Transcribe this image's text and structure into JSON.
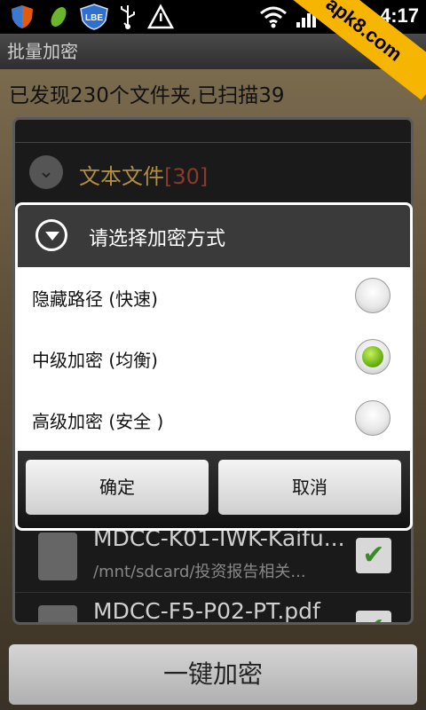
{
  "status_bar": {
    "clock": "4:17",
    "icons": [
      "shield-icon",
      "leaf-icon",
      "lbe-badge-icon",
      "usb-icon",
      "warning-icon",
      "wifi-icon",
      "signal-icon",
      "battery-icon"
    ],
    "lbe_label": "LBE"
  },
  "watermark": "apk8.com",
  "title_bar": {
    "title": "批量加密"
  },
  "scan_status": "已发现230个文件夹,已扫描39",
  "folder": {
    "name": "文本文件",
    "count": "[30]"
  },
  "files": [
    {
      "name": "MDCC-K01-IWK-Kaifu...",
      "path": "/mnt/sdcard/投资报告相关...",
      "checked": true
    },
    {
      "name": "MDCC-F5-P02-PT.pdf",
      "path": "",
      "checked": true
    }
  ],
  "dialog": {
    "title": "请选择加密方式",
    "options": [
      {
        "label": "隐藏路径 (快速)",
        "selected": false
      },
      {
        "label": "中级加密 (均衡)",
        "selected": true
      },
      {
        "label": "高级加密 (安全 )",
        "selected": false
      }
    ],
    "confirm_label": "确定",
    "cancel_label": "取消"
  },
  "main_action": {
    "label": "一键加密"
  },
  "colors": {
    "accent_green": "#6cb515",
    "folder_text": "#b18f40",
    "watermark_bg": "#f6b500"
  }
}
